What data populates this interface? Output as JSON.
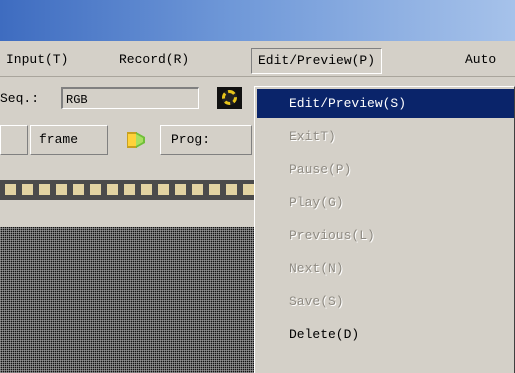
{
  "menubar": {
    "items": [
      {
        "label": "Input(T)"
      },
      {
        "label": "Record(R)"
      },
      {
        "label": "Edit/Preview(P)"
      },
      {
        "label": "Auto"
      }
    ]
  },
  "toolbar": {
    "seq_label": "Seq.:",
    "seq_value": "RGB",
    "frame_label": "frame",
    "prog_label": "Prog:"
  },
  "dropdown": {
    "items": [
      {
        "label": "Edit/Preview(S)",
        "state": "selected"
      },
      {
        "label": "ExitT)",
        "state": "disabled"
      },
      {
        "label": "Pause(P)",
        "state": "disabled"
      },
      {
        "label": "Play(G)",
        "state": "disabled"
      },
      {
        "label": "Previous(L)",
        "state": "disabled"
      },
      {
        "label": "Next(N)",
        "state": "disabled"
      },
      {
        "label": "Save(S)",
        "state": "disabled"
      },
      {
        "label": "Delete(D)",
        "state": "enabled"
      }
    ]
  },
  "colors": {
    "selection": "#0a246a",
    "face": "#d4d0c8",
    "disabled_text": "#8f8b83"
  },
  "icons": [
    "color-ring-icon",
    "film-roll-icon"
  ]
}
